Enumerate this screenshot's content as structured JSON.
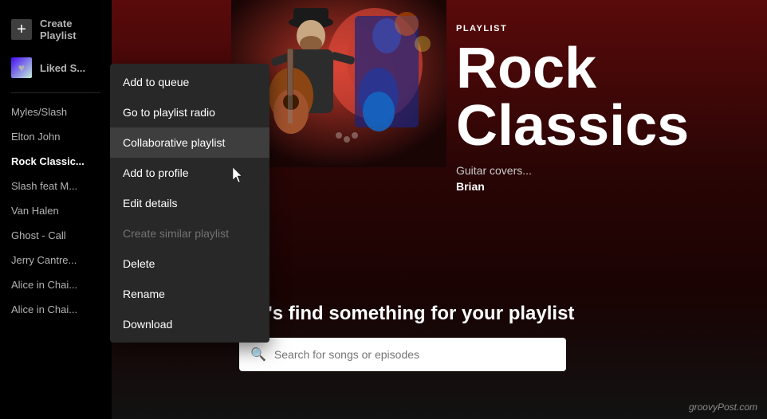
{
  "sidebar": {
    "create_playlist_label": "Create Playlist",
    "liked_songs_label": "Liked S...",
    "playlists": [
      {
        "id": "myles-slash",
        "label": "Myles/Slash"
      },
      {
        "id": "elton-john",
        "label": "Elton John"
      },
      {
        "id": "rock-classics",
        "label": "Rock Classic...",
        "active": true
      },
      {
        "id": "slash-feat",
        "label": "Slash feat M..."
      },
      {
        "id": "van-halen",
        "label": "Van Halen"
      },
      {
        "id": "ghost-call",
        "label": "Ghost - Call"
      },
      {
        "id": "jerry",
        "label": "Jerry Cantre..."
      },
      {
        "id": "alice1",
        "label": "Alice in Chai..."
      },
      {
        "id": "alice2",
        "label": "Alice in Chai..."
      }
    ]
  },
  "playlist_info": {
    "label": "PLAYLIST",
    "title": "Rock Classics",
    "description": "Guitar covers...",
    "owner": "Brian"
  },
  "context_menu": {
    "items": [
      {
        "id": "add-to-queue",
        "label": "Add to queue",
        "disabled": false
      },
      {
        "id": "go-to-playlist-radio",
        "label": "Go to playlist radio",
        "disabled": false
      },
      {
        "id": "collaborative-playlist",
        "label": "Collaborative playlist",
        "active": true,
        "disabled": false
      },
      {
        "id": "add-to-profile",
        "label": "Add to profile",
        "disabled": false
      },
      {
        "id": "edit-details",
        "label": "Edit details",
        "disabled": false
      },
      {
        "id": "create-similar-playlist",
        "label": "Create similar playlist",
        "disabled": true
      },
      {
        "id": "delete",
        "label": "Delete",
        "disabled": false
      },
      {
        "id": "rename",
        "label": "Rename",
        "disabled": false
      },
      {
        "id": "download",
        "label": "Download",
        "disabled": false
      }
    ]
  },
  "find_section": {
    "title": "et's find something for your playlist",
    "search_placeholder": "Search for songs or episodes"
  },
  "watermark": "groovyPost.com"
}
